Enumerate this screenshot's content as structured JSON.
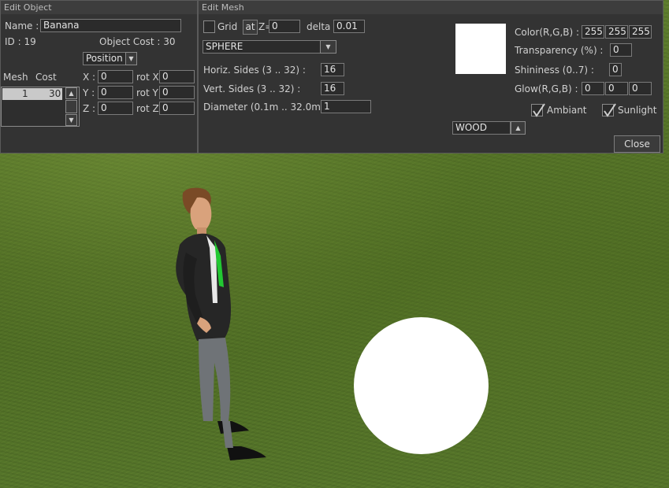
{
  "edit_object": {
    "title": "Edit Object",
    "name_label": "Name :",
    "name_value": "Banana",
    "id_label": "ID : 19",
    "cost_label": "Object Cost : 30",
    "mode_value": "Position",
    "mesh_header": "Mesh",
    "cost_header": "Cost",
    "rows": [
      {
        "mesh": "1",
        "cost": "30"
      }
    ],
    "x_label": "X :",
    "x_value": "0",
    "y_label": "Y :",
    "y_value": "0",
    "z_label": "Z :",
    "z_value": "0",
    "rotx_label": "rot X",
    "rotx_value": "0",
    "roty_label": "rot Y",
    "roty_value": "0",
    "rotz_label": "rot Z",
    "rotz_value": "0"
  },
  "edit_mesh": {
    "title": "Edit Mesh",
    "grid_label": "Grid",
    "at_label": "at",
    "z_label": "Z=",
    "z_value": "0",
    "delta_label": "delta",
    "delta_value": "0.01",
    "shape_value": "SPHERE",
    "horiz_label": "Horiz. Sides (3 .. 32) :",
    "horiz_value": "16",
    "vert_label": "Vert. Sides (3 .. 32) :",
    "vert_value": "16",
    "diameter_label": "Diameter (0.1m .. 32.0m) :",
    "diameter_value": "1",
    "color_label": "Color(R,G,B) :",
    "color_r": "255",
    "color_g": "255",
    "color_b": "255",
    "swatch_color": "#ffffff",
    "transparency_label": "Transparency (%) :",
    "transparency_value": "0",
    "shininess_label": "Shininess (0..7) :",
    "shininess_value": "0",
    "glow_label": "Glow(R,G,B) :",
    "glow_r": "0",
    "glow_g": "0",
    "glow_b": "0",
    "ambiant_label": "Ambiant",
    "ambiant_checked": true,
    "sunlight_label": "Sunlight",
    "sunlight_checked": true,
    "texture_value": "WOOD",
    "close_label": "Close"
  },
  "colors": {
    "panel_bg": "#333333",
    "grass": "#55752a",
    "sphere": "#ffffff"
  }
}
